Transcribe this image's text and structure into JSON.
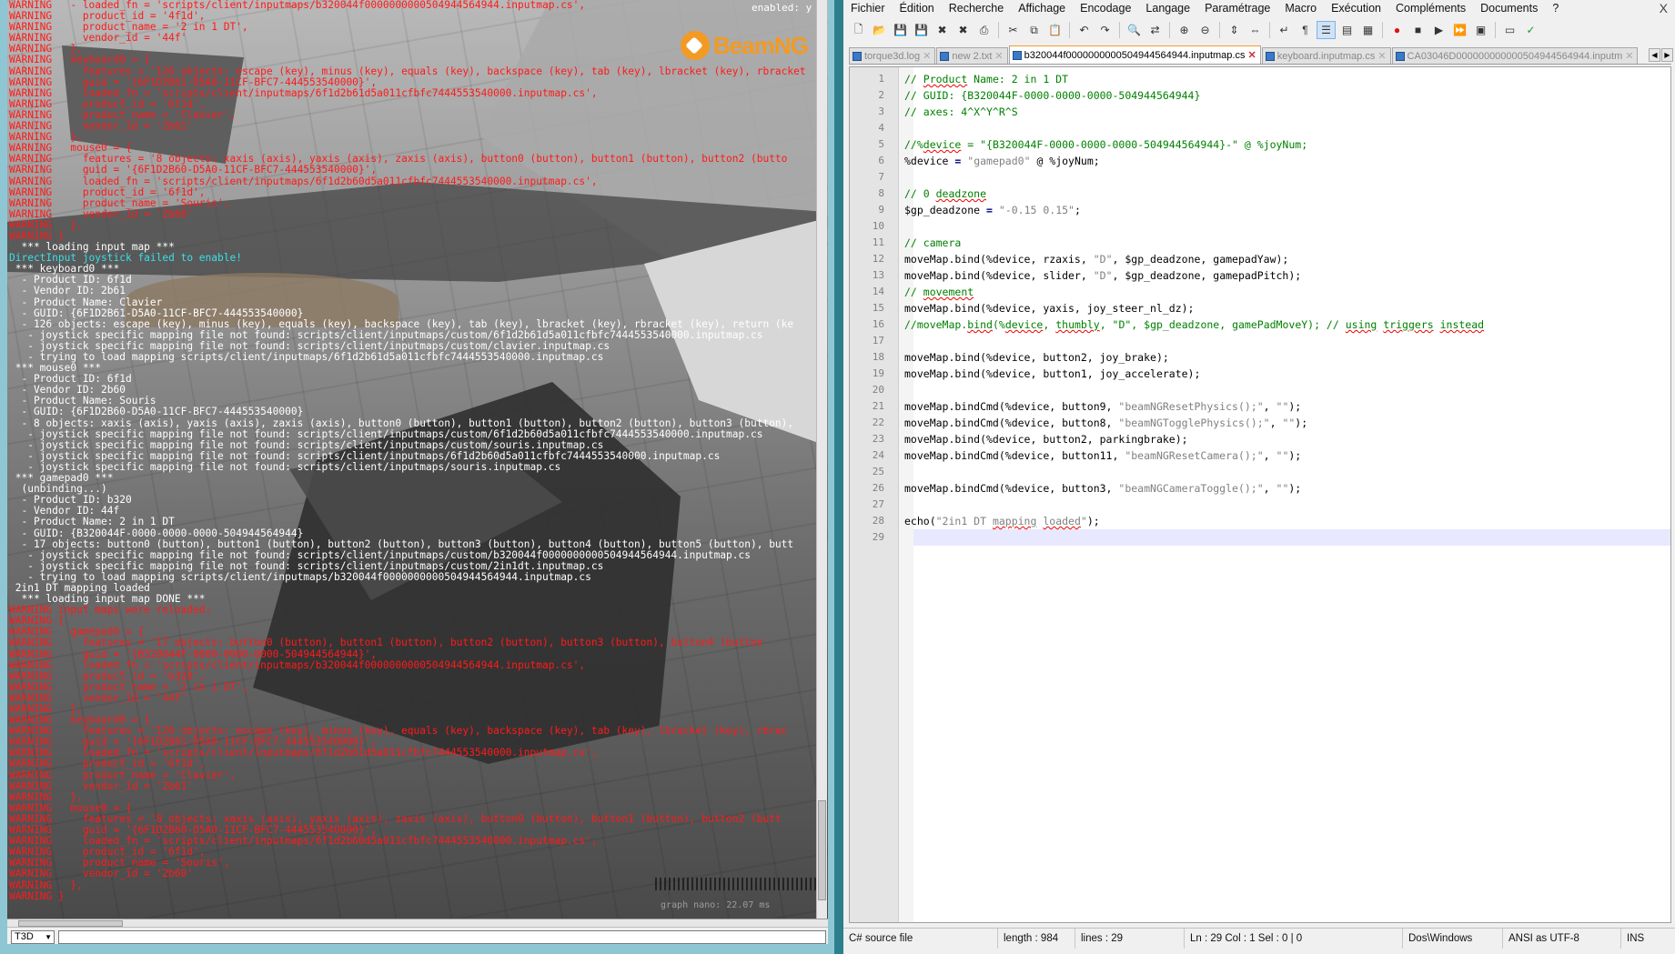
{
  "game": {
    "logo": "BeamNG",
    "enabled_label": "enabled: y",
    "perf_label": "graph nano: 22.07 ms",
    "console_type_select": "T3D",
    "console_lines": [
      {
        "t": "w",
        "s": "WARNING   - loaded_fn = 'scripts/client/inputmaps/b320044f0000000000504944564944.inputmap.cs',"
      },
      {
        "t": "w",
        "s": "WARNING     product_id = '4f1d',"
      },
      {
        "t": "w",
        "s": "WARNING     product_name = '2 in 1 DT',"
      },
      {
        "t": "w",
        "s": "WARNING     vendor_id = '44f'"
      },
      {
        "t": "w",
        "s": "WARNING   },"
      },
      {
        "t": "w",
        "s": "WARNING   keyboard0 = {"
      },
      {
        "t": "w",
        "s": "WARNING     features = '126 objects: escape (key), minus (key), equals (key), backspace (key), tab (key), lbracket (key), rbracket"
      },
      {
        "t": "w",
        "s": "WARNING     guid = '{6F1D2B61-D5A0-11CF-BFC7-444553540000}',"
      },
      {
        "t": "w",
        "s": "WARNING     loaded_fn = 'scripts/client/inputmaps/6f1d2b61d5a011cfbfc7444553540000.inputmap.cs',"
      },
      {
        "t": "w",
        "s": "WARNING     product_id = '6f1d',"
      },
      {
        "t": "w",
        "s": "WARNING     product_name = 'Clavier',"
      },
      {
        "t": "w",
        "s": "WARNING     vendor_id = '2b61'"
      },
      {
        "t": "w",
        "s": "WARNING   },"
      },
      {
        "t": "w",
        "s": "WARNING   mouse0 = {"
      },
      {
        "t": "w",
        "s": "WARNING     features = '8 objects: xaxis (axis), yaxis (axis), zaxis (axis), button0 (button), button1 (button), button2 (butto"
      },
      {
        "t": "w",
        "s": "WARNING     guid = '{6F1D2B60-D5A0-11CF-BFC7-444553540000}',"
      },
      {
        "t": "w",
        "s": "WARNING     loaded_fn = 'scripts/client/inputmaps/6f1d2b60d5a011cfbfc7444553540000.inputmap.cs',"
      },
      {
        "t": "w",
        "s": "WARNING     product_id = '6f1d',"
      },
      {
        "t": "w",
        "s": "WARNING     product_name = 'Souris',"
      },
      {
        "t": "w",
        "s": "WARNING     vendor_id = '2b60'"
      },
      {
        "t": "w",
        "s": "WARNING   },"
      },
      {
        "t": "w",
        "s": "WARNING }"
      },
      {
        "t": "n",
        "s": "  *** loading input map ***"
      },
      {
        "t": "c",
        "s": "DirectInput joystick failed to enable!"
      },
      {
        "t": "n",
        "s": " *** keyboard0 ***"
      },
      {
        "t": "n",
        "s": "  - Product ID: 6f1d"
      },
      {
        "t": "n",
        "s": "  - Vendor ID: 2b61"
      },
      {
        "t": "n",
        "s": "  - Product Name: Clavier"
      },
      {
        "t": "n",
        "s": "  - GUID: {6F1D2B61-D5A0-11CF-BFC7-444553540000}"
      },
      {
        "t": "n",
        "s": "  - 126 objects: escape (key), minus (key), equals (key), backspace (key), tab (key), lbracket (key), rbracket (key), return (ke"
      },
      {
        "t": "n",
        "s": "   - joystick specific mapping file not found: scripts/client/inputmaps/custom/6f1d2b61d5a011cfbfc7444553540000.inputmap.cs"
      },
      {
        "t": "n",
        "s": "   - joystick specific mapping file not found: scripts/client/inputmaps/custom/clavier.inputmap.cs"
      },
      {
        "t": "n",
        "s": "   - trying to load mapping scripts/client/inputmaps/6f1d2b61d5a011cfbfc7444553540000.inputmap.cs"
      },
      {
        "t": "n",
        "s": " *** mouse0 ***"
      },
      {
        "t": "n",
        "s": "  - Product ID: 6f1d"
      },
      {
        "t": "n",
        "s": "  - Vendor ID: 2b60"
      },
      {
        "t": "n",
        "s": "  - Product Name: Souris"
      },
      {
        "t": "n",
        "s": "  - GUID: {6F1D2B60-D5A0-11CF-BFC7-444553540000}"
      },
      {
        "t": "n",
        "s": "  - 8 objects: xaxis (axis), yaxis (axis), zaxis (axis), button0 (button), button1 (button), button2 (button), button3 (button),"
      },
      {
        "t": "n",
        "s": "   - joystick specific mapping file not found: scripts/client/inputmaps/custom/6f1d2b60d5a011cfbfc7444553540000.inputmap.cs"
      },
      {
        "t": "n",
        "s": "   - joystick specific mapping file not found: scripts/client/inputmaps/custom/souris.inputmap.cs"
      },
      {
        "t": "n",
        "s": "   - joystick specific mapping file not found: scripts/client/inputmaps/6f1d2b60d5a011cfbfc7444553540000.inputmap.cs"
      },
      {
        "t": "n",
        "s": "   - joystick specific mapping file not found: scripts/client/inputmaps/souris.inputmap.cs"
      },
      {
        "t": "n",
        "s": " *** gamepad0 ***"
      },
      {
        "t": "n",
        "s": "  (unbinding...)"
      },
      {
        "t": "n",
        "s": "  - Product ID: b320"
      },
      {
        "t": "n",
        "s": "  - Vendor ID: 44f"
      },
      {
        "t": "n",
        "s": "  - Product Name: 2 in 1 DT"
      },
      {
        "t": "n",
        "s": "  - GUID: {B320044F-0000-0000-0000-504944564944}"
      },
      {
        "t": "n",
        "s": "  - 17 objects: button0 (button), button1 (button), button2 (button), button3 (button), button4 (button), button5 (button), butt"
      },
      {
        "t": "n",
        "s": "   - joystick specific mapping file not found: scripts/client/inputmaps/custom/b320044f0000000000504944564944.inputmap.cs"
      },
      {
        "t": "n",
        "s": "   - joystick specific mapping file not found: scripts/client/inputmaps/custom/2in1dt.inputmap.cs"
      },
      {
        "t": "n",
        "s": "   - trying to load mapping scripts/client/inputmaps/b320044f0000000000504944564944.inputmap.cs"
      },
      {
        "t": "n",
        "s": " 2in1 DT mapping loaded"
      },
      {
        "t": "n",
        "s": "  *** loading input map DONE ***"
      },
      {
        "t": "w",
        "s": "WARNING input maps were reloaded:"
      },
      {
        "t": "w",
        "s": "WARNING {"
      },
      {
        "t": "w",
        "s": "WARNING   gamepad0 = {"
      },
      {
        "t": "w",
        "s": "WARNING     features = '17 objects: button0 (button), button1 (button), button2 (button), button3 (button), button4 (button"
      },
      {
        "t": "w",
        "s": "WARNING     guid = '{B320044F-0000-0000-0000-504944564944}',"
      },
      {
        "t": "w",
        "s": "WARNING     loaded_fn = 'scripts/client/inputmaps/b320044f0000000000504944564944.inputmap.cs',"
      },
      {
        "t": "w",
        "s": "WARNING     product_id = 'b320',"
      },
      {
        "t": "w",
        "s": "WARNING     product_name = '2 in 1 DT',"
      },
      {
        "t": "w",
        "s": "WARNING     vendor_id = '44f'"
      },
      {
        "t": "w",
        "s": "WARNING   },"
      },
      {
        "t": "w",
        "s": "WARNING   keyboard0 = {"
      },
      {
        "t": "w",
        "s": "WARNING     features = '126 objects: escape (key), minus (key), equals (key), backspace (key), tab (key), lbracket (key), rbrac"
      },
      {
        "t": "w",
        "s": "WARNING     guid = '{6F1D2B61-D5A0-11CF-BFC7-444553540000}',"
      },
      {
        "t": "w",
        "s": "WARNING     loaded_fn = 'scripts/client/inputmaps/6f1d2b61d5a011cfbfc7444553540000.inputmap.cs',"
      },
      {
        "t": "w",
        "s": "WARNING     product_id = '6f1d',"
      },
      {
        "t": "w",
        "s": "WARNING     product_name = 'Clavier',"
      },
      {
        "t": "w",
        "s": "WARNING     vendor_id = '2b61'"
      },
      {
        "t": "w",
        "s": "WARNING   },"
      },
      {
        "t": "w",
        "s": "WARNING   mouse0 = {"
      },
      {
        "t": "w",
        "s": "WARNING     features = '8 objects: xaxis (axis), yaxis (axis), zaxis (axis), button0 (button), button1 (button), button2 (butt"
      },
      {
        "t": "w",
        "s": "WARNING     guid = '{6F1D2B60-D5A0-11CF-BFC7-444553540000}',"
      },
      {
        "t": "w",
        "s": "WARNING     loaded_fn = 'scripts/client/inputmaps/6f1d2b60d5a011cfbfc7444553540000.inputmap.cs',"
      },
      {
        "t": "w",
        "s": "WARNING     product_id = '6f1d',"
      },
      {
        "t": "w",
        "s": "WARNING     product_name = 'Souris',"
      },
      {
        "t": "w",
        "s": "WARNING     vendor_id = '2b60'"
      },
      {
        "t": "w",
        "s": "WARNING   },"
      },
      {
        "t": "w",
        "s": "WARNING }"
      }
    ]
  },
  "npp": {
    "menu": [
      "Fichier",
      "Édition",
      "Recherche",
      "Affichage",
      "Encodage",
      "Langage",
      "Paramétrage",
      "Macro",
      "Exécution",
      "Compléments",
      "Documents",
      "?"
    ],
    "close_label": "X",
    "toolbar_icons": [
      "new-file-icon",
      "open-file-icon",
      "save-icon",
      "save-all-icon",
      "close-icon",
      "close-all-icon",
      "print-icon",
      "sep",
      "cut-icon",
      "copy-icon",
      "paste-icon",
      "sep",
      "undo-icon",
      "redo-icon",
      "sep",
      "find-icon",
      "replace-icon",
      "sep",
      "zoom-in-icon",
      "zoom-out-icon",
      "sep",
      "sync-vertical-icon",
      "sync-horizontal-icon",
      "sep",
      "word-wrap-icon",
      "show-all-chars-icon",
      "indent-guide-icon",
      "user-lang-icon",
      "doc-map-icon",
      "sep",
      "record-macro-icon",
      "stop-record-icon",
      "play-macro-icon",
      "run-macro-multiple-icon",
      "save-macro-icon",
      "sep",
      "launch-icon",
      "spellcheck-icon"
    ],
    "tabs": [
      {
        "label": "torque3d.log",
        "active": false
      },
      {
        "label": "new  2.txt",
        "active": false
      },
      {
        "label": "b320044f0000000000504944564944.inputmap.cs",
        "active": true
      },
      {
        "label": "keyboard.inputmap.cs",
        "active": false
      },
      {
        "label": "CA03046D000000000000504944564944.inputm",
        "active": false
      }
    ],
    "code_lines": [
      "<span class=\"cm\">// <span class=\"sq\">Product</span> Name: 2 in 1 DT</span>",
      "<span class=\"cm\">// GUID: {B320044F-0000-0000-0000-504944564944}</span>",
      "<span class=\"cm\">// axes: 4^X^Y^R^S</span>",
      "",
      "<span class=\"cm\">//%<span class=\"sq\">device</span> = \"{B320044F-0000-0000-0000-504944564944}-\" @ %joyNum;</span>",
      "%device <span class=\"op\">=</span> <span class=\"st\">\"gamepad0\"</span> @ %joyNum;",
      "",
      "<span class=\"cm\">// 0 <span class=\"sq\">deadzone</span></span>",
      "$gp_deadzone <span class=\"op\">=</span> <span class=\"st\">\"-0.15 0.15\"</span>;",
      "",
      "<span class=\"cm\">// camera</span>",
      "moveMap.bind(%device, rzaxis, <span class=\"st\">\"D\"</span>, $gp_deadzone, gamepadYaw);",
      "moveMap.bind(%device, slider, <span class=\"st\">\"D\"</span>, $gp_deadzone, gamepadPitch);",
      "<span class=\"cm\">// <span class=\"sq\">movement</span></span>",
      "moveMap.bind(%device, yaxis, joy_steer_nl_dz);",
      "<span class=\"cm\">//moveMap.<span class=\"sq\">bind</span>(%<span class=\"sq\">device</span>, <span class=\"sq\">thumbly</span>, \"D\", $gp_deadzone, gamePadMoveY); // <span class=\"sq\">using</span> <span class=\"sq\">triggers</span> <span class=\"sq\">instead</span></span>",
      "",
      "moveMap.bind(%device, button2, joy_brake);",
      "moveMap.bind(%device, button1, joy_accelerate);",
      "",
      "moveMap.bindCmd(%device, button9, <span class=\"st\">\"beamNGResetPhysics();\"</span>, <span class=\"st\">\"\"</span>);",
      "moveMap.bindCmd(%device, button8, <span class=\"st\">\"beamNGTogglePhysics();\"</span>, <span class=\"st\">\"\"</span>);",
      "moveMap.bind(%device, button2, parkingbrake);",
      "moveMap.bindCmd(%device, button11, <span class=\"st\">\"beamNGResetCamera();\"</span>, <span class=\"st\">\"\"</span>);",
      "",
      "moveMap.bindCmd(%device, button3, <span class=\"st\">\"beamNGCameraToggle();\"</span>, <span class=\"st\">\"\"</span>);",
      "",
      "echo(<span class=\"st\">\"2in1 DT <span class=\"sq\">mapping</span> <span class=\"sq\">loaded</span>\"</span>);",
      ""
    ],
    "current_line": 29,
    "status": {
      "file_type": "C# source file",
      "length": "length : 984",
      "lines": "lines : 29",
      "position": "Ln : 29    Col : 1    Sel : 0 | 0",
      "eol": "Dos\\Windows",
      "encoding": "ANSI as UTF-8",
      "mode": "INS"
    }
  },
  "colors": {
    "warning": "#ff1a1a",
    "info": "#ffffff",
    "joystick_error": "#36e0e8",
    "beamng_orange": "#f29a23",
    "active_tab_accent": "#fa9a28",
    "comment_green": "#008000"
  }
}
